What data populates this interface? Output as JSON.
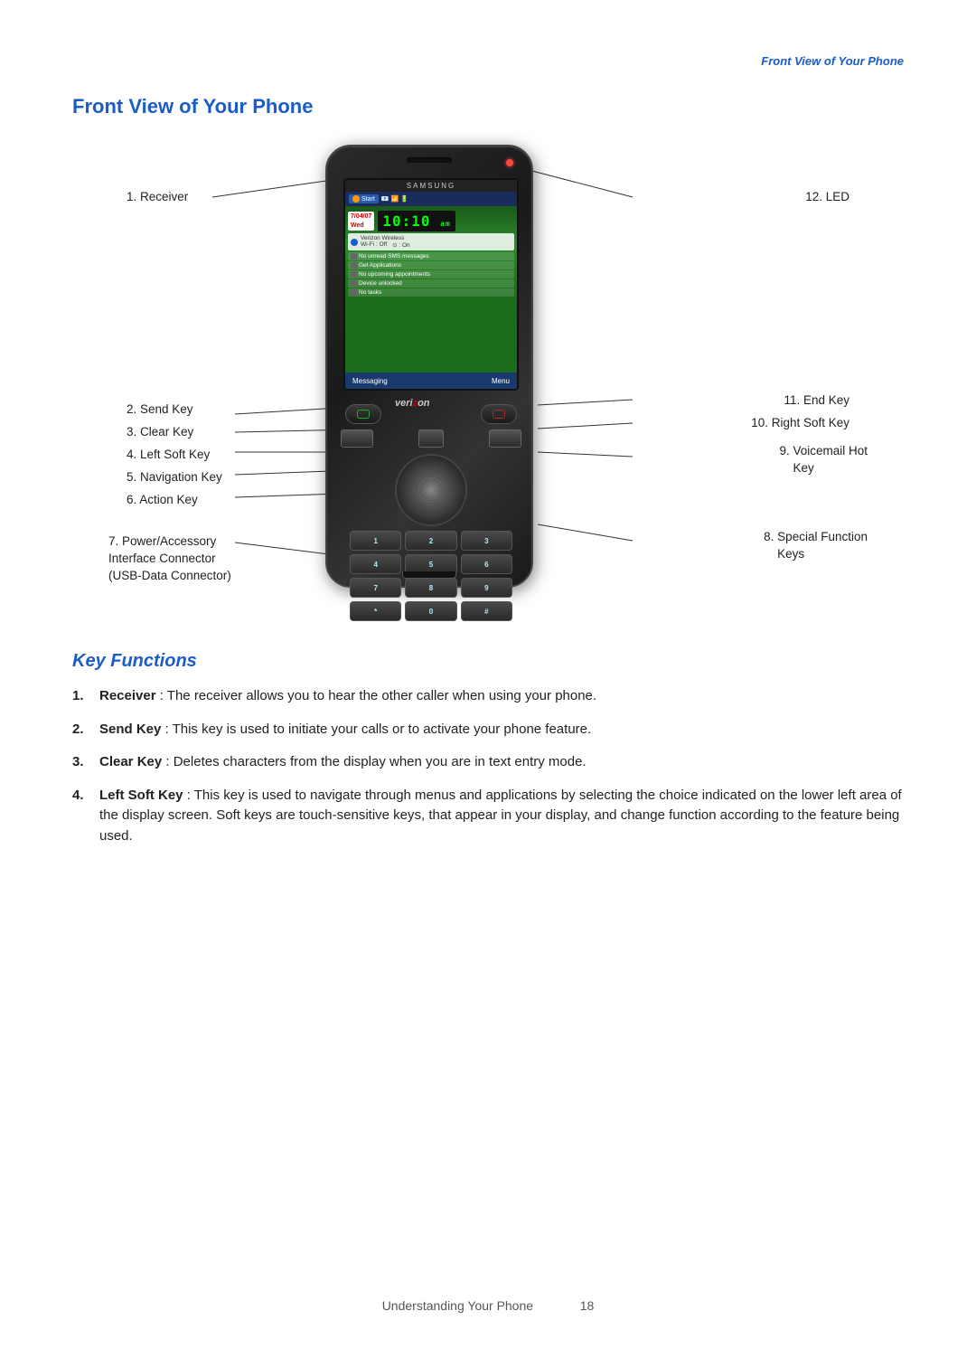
{
  "header": {
    "section_label": "Front View of Your Phone"
  },
  "page_title": "Front View of Your Phone",
  "diagram": {
    "phone": {
      "screen": {
        "samsung_text": "SAMSUNG",
        "start_button": "Start",
        "date": "7/04/07",
        "day": "Wed",
        "time": "10:10",
        "ampm": "am",
        "carrier": "Verizon Wireless",
        "wifi": "Wi-Fi : Off",
        "bluetooth": "⊙ : On",
        "sms": "No unread SMS messages",
        "apps": "Get Applications",
        "appointments": "No upcoming appointments",
        "device": "Device unlocked",
        "tasks": "No tasks",
        "messaging_btn": "Messaging",
        "menu_btn": "Menu",
        "verizon": "verizon"
      }
    },
    "labels": {
      "left": [
        {
          "number": "1.",
          "text": "Receiver"
        },
        {
          "number": "2.",
          "text": "Send Key"
        },
        {
          "number": "3.",
          "text": "Clear Key"
        },
        {
          "number": "4.",
          "text": "Left Soft Key"
        },
        {
          "number": "5.",
          "text": "Navigation Key"
        },
        {
          "number": "6.",
          "text": "Action Key"
        },
        {
          "number": "7.",
          "text": "Power/Accessory Interface Connector\n(USB-Data Connector)"
        }
      ],
      "right": [
        {
          "number": "12.",
          "text": "LED"
        },
        {
          "number": "11.",
          "text": "End Key"
        },
        {
          "number": "10.",
          "text": "Right Soft Key"
        },
        {
          "number": "9.",
          "text": "Voicemail Hot\nKey"
        },
        {
          "number": "8.",
          "text": "Special Function\nKeys"
        }
      ]
    }
  },
  "key_functions": {
    "title": "Key Functions",
    "items": [
      {
        "number": "1.",
        "name": "Receiver",
        "description": ": The receiver allows you to hear the other caller when using your phone."
      },
      {
        "number": "2.",
        "name": "Send Key",
        "description": ": This key is used to initiate your calls or to activate your phone feature."
      },
      {
        "number": "3.",
        "name": "Clear Key",
        "description": ": Deletes characters from the display when you are in text entry mode."
      },
      {
        "number": "4.",
        "name": "Left Soft Key",
        "description": ": This key is used to navigate through menus and applications by selecting the choice indicated on the lower left area of the display screen. Soft keys are touch-sensitive keys, that appear in your display, and change function according to the feature being used."
      }
    ]
  },
  "footer": {
    "text": "Understanding Your Phone",
    "page_number": "18"
  }
}
